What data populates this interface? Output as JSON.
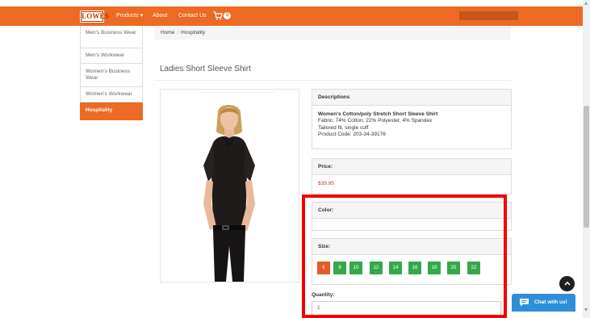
{
  "navbar": {
    "logo_text": "LOWES",
    "items": [
      {
        "label": "Products ▾"
      },
      {
        "label": "About"
      },
      {
        "label": "Contact Us"
      }
    ],
    "cart_count": "0"
  },
  "sidebar": {
    "items": [
      {
        "label": "Men's Business Wear"
      },
      {
        "label": "Men's Workwear"
      },
      {
        "label": "Women's Business Wear"
      },
      {
        "label": "Women's Workwear"
      },
      {
        "label": "Hospitality",
        "active": true
      }
    ]
  },
  "breadcrumb": {
    "home": "Home",
    "separator": "/",
    "current": "Hospitality"
  },
  "product": {
    "title": "Ladies Short Sleeve Shirt",
    "descriptions_heading": "Descriptions",
    "description_name": "Women's Cotton/poly Stretch Short Sleeve Shirt",
    "description_lines": [
      "Fabric: 74% Cotton, 22% Polyester, 4% Spandex",
      "Tailored fit, single cuff",
      "Product Code: 203-34-39176"
    ],
    "price_heading": "Price:",
    "price": "$39.95",
    "color_heading": "Color:",
    "size_heading": "Size:",
    "sizes": [
      "6",
      "8",
      "10",
      "12",
      "14",
      "16",
      "18",
      "20",
      "22"
    ],
    "selected_size": "6",
    "quantity_label": "Quantity:",
    "quantity_value": "1"
  },
  "chat": {
    "label": "Chat with us!"
  },
  "colors": {
    "brand": "#ec6a23",
    "size_button": "#35a84a",
    "size_selected": "#e95a26",
    "highlight": "#f20000",
    "chat": "#2f8ed8"
  }
}
